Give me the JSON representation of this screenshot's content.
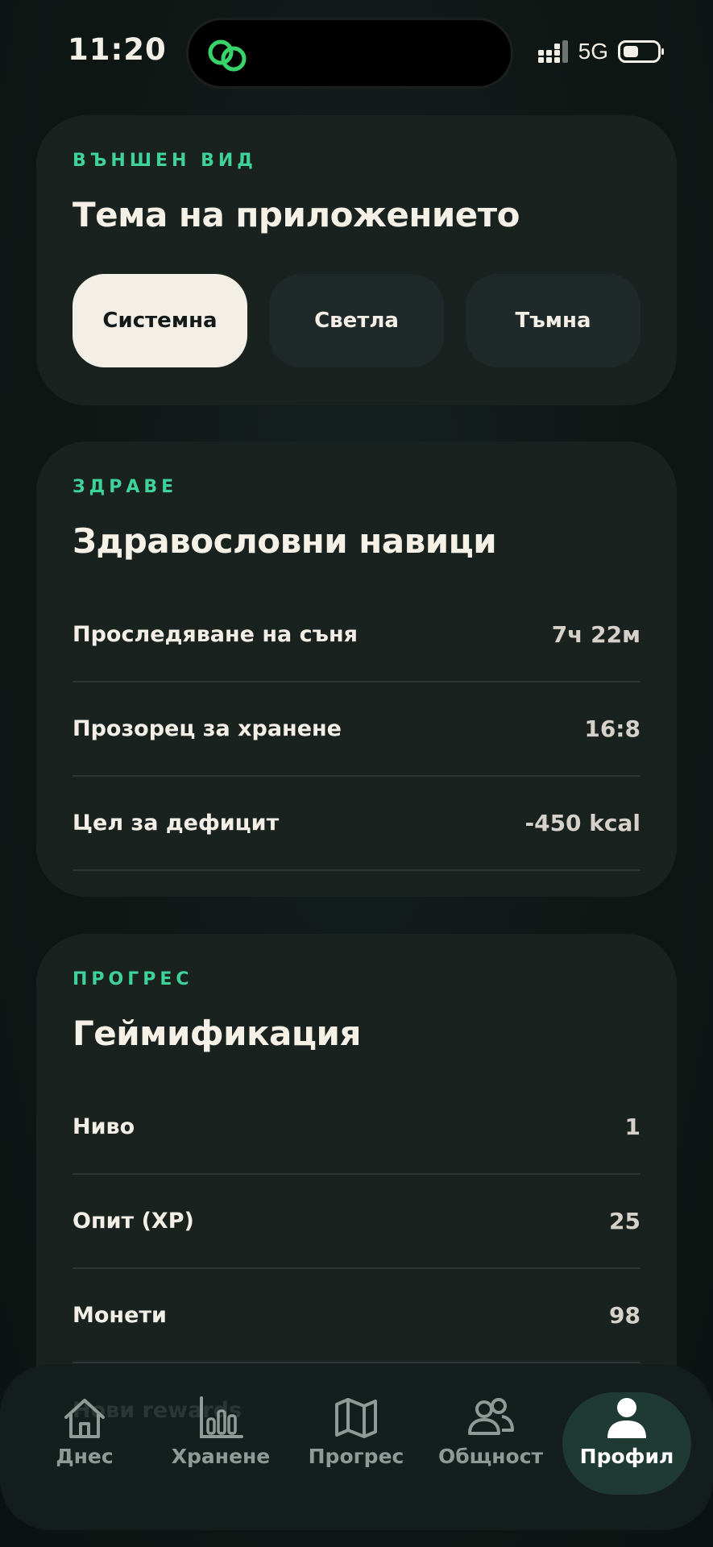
{
  "status": {
    "time": "11:20",
    "network": "5G"
  },
  "appearance": {
    "eyebrow": "ВЪНШЕН ВИД",
    "title": "Тема на приложението",
    "options": [
      "Системна",
      "Светла",
      "Тъмна"
    ],
    "selected": "Системна"
  },
  "health": {
    "eyebrow": "ЗДРАВЕ",
    "title": "Здравословни навици",
    "rows": [
      {
        "label": "Проследяване на съня",
        "value": "7ч 22м"
      },
      {
        "label": "Прозорец за хранене",
        "value": "16:8"
      },
      {
        "label": "Цел за дефицит",
        "value": "-450 kcal"
      }
    ]
  },
  "progress": {
    "eyebrow": "ПРОГРЕС",
    "title": "Геймификация",
    "rows": [
      {
        "label": "Ниво",
        "value": "1"
      },
      {
        "label": "Опит (XP)",
        "value": "25"
      },
      {
        "label": "Монети",
        "value": "98"
      }
    ],
    "faded_row_label": "Нови rewards"
  },
  "nav": {
    "items": [
      {
        "label": "Днес",
        "icon": "home-icon"
      },
      {
        "label": "Хранене",
        "icon": "bar-chart-icon"
      },
      {
        "label": "Прогрес",
        "icon": "map-icon"
      },
      {
        "label": "Общност",
        "icon": "people-icon"
      },
      {
        "label": "Профил",
        "icon": "user-icon"
      }
    ],
    "active": "Профил"
  },
  "colors": {
    "accent": "#3dd39a",
    "card": "#1a2220",
    "active_nav": "#1e3a33"
  }
}
